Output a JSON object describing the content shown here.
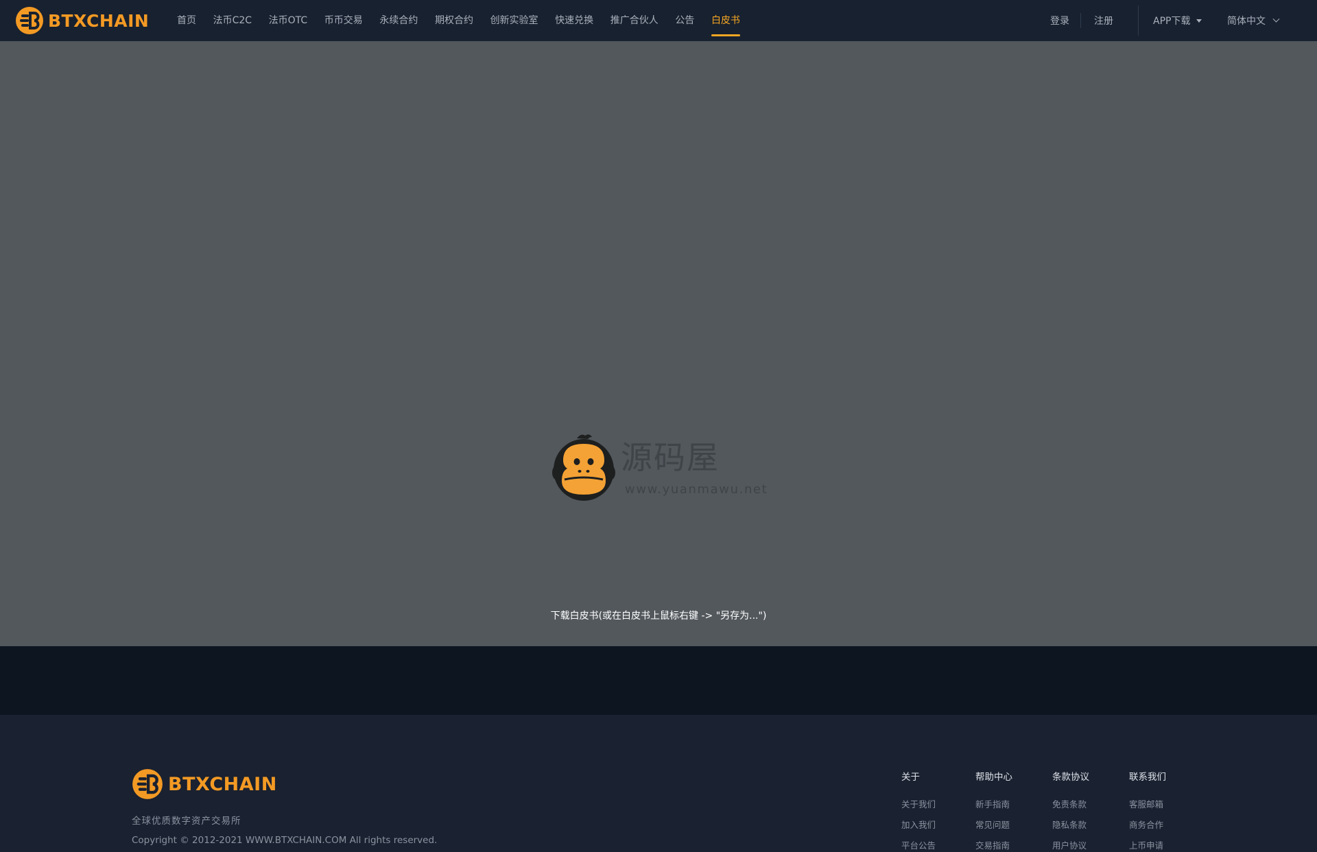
{
  "brand": {
    "name": "BTXCHAIN",
    "color": "#f39a24"
  },
  "nav": {
    "items": [
      {
        "label": "首页",
        "active": false
      },
      {
        "label": "法币C2C",
        "active": false
      },
      {
        "label": "法币OTC",
        "active": false
      },
      {
        "label": "币币交易",
        "active": false
      },
      {
        "label": "永续合约",
        "active": false
      },
      {
        "label": "期权合约",
        "active": false
      },
      {
        "label": "创新实验室",
        "active": false
      },
      {
        "label": "快速兑换",
        "active": false
      },
      {
        "label": "推广合伙人",
        "active": false
      },
      {
        "label": "公告",
        "active": false
      },
      {
        "label": "白皮书",
        "active": true
      }
    ],
    "active_color": "#f5a623"
  },
  "auth": {
    "login": "登录",
    "register": "注册"
  },
  "app_download": "APP下载",
  "language": "简体中文",
  "main": {
    "watermark_cn": "源码屋",
    "watermark_url": "www.yuanmawu.net",
    "download_text": "下载白皮书(或在白皮书上鼠标右键 -> \"另存为...\")"
  },
  "footer": {
    "slogan": "全球优质数字资产交易所",
    "copyright": "Copyright © 2012-2021 WWW.BTXCHAIN.COM All rights reserved.",
    "columns": [
      {
        "title": "关于",
        "links": [
          "关于我们",
          "加入我们",
          "平台公告"
        ]
      },
      {
        "title": "帮助中心",
        "links": [
          "新手指南",
          "常见问题",
          "交易指南"
        ]
      },
      {
        "title": "条款协议",
        "links": [
          "免责条款",
          "隐私条款",
          "用户协议"
        ]
      },
      {
        "title": "联系我们",
        "links": [
          "客服邮箱",
          "商务合作",
          "上币申请"
        ]
      }
    ]
  }
}
